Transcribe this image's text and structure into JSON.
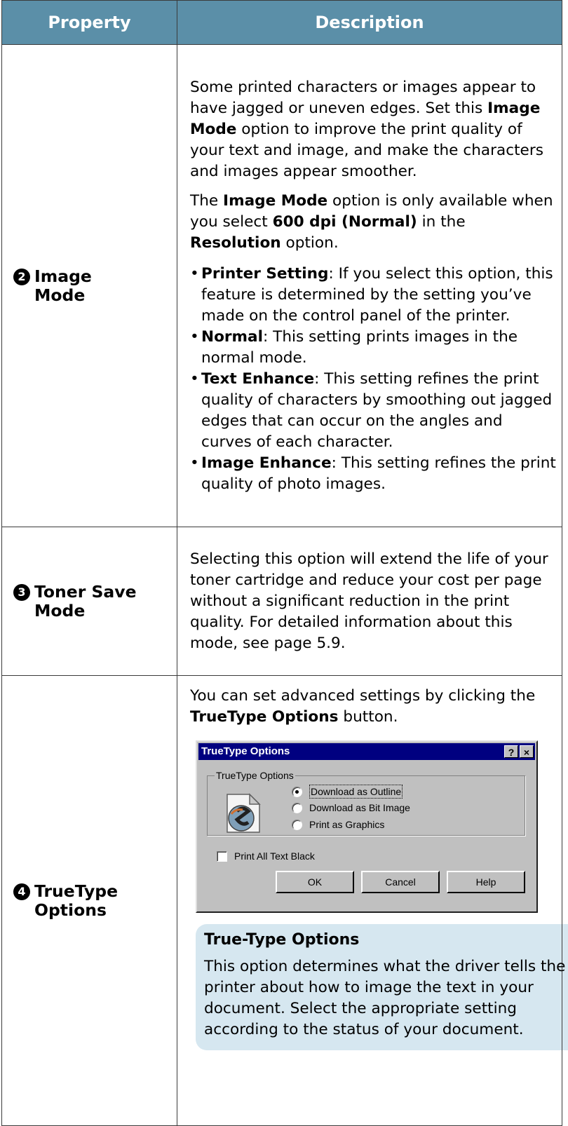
{
  "table": {
    "headers": {
      "property": "Property",
      "description": "Description"
    }
  },
  "rows": {
    "image_mode": {
      "number": "2",
      "name": "Image\nMode",
      "para1": {
        "pre": "Some printed characters or images appear to have jagged or uneven edges. Set this ",
        "bold": "Image Mode",
        "post": " option to improve the print quality of your text and image, and make the characters and images appear smoother."
      },
      "para2": {
        "t1": "The ",
        "b1": "Image Mode",
        "t2": " option is only available when you select ",
        "b2": "600 dpi (Normal)",
        "t3": " in the ",
        "b3": "Resolution",
        "t4": " option."
      },
      "options": [
        {
          "bold": "Printer Setting",
          "text": ": If you select this option, this feature is determined by the setting you’ve made on the control panel of the printer."
        },
        {
          "bold": "Normal",
          "text": ": This setting prints images in the normal mode."
        },
        {
          "bold": "Text Enhance",
          "text": ": This setting refines the print quality of characters by smoothing out jagged edges that can occur on the angles and curves of each character."
        },
        {
          "bold": "Image Enhance",
          "text": ": This setting refines the print quality of photo images."
        }
      ]
    },
    "toner_save": {
      "number": "3",
      "name": "Toner Save\nMode",
      "text": "Selecting this option will extend the life of your toner cartridge and reduce your cost per page without a significant reduction in the print quality. For detailed information about this mode, see page 5.9."
    },
    "truetype": {
      "number": "4",
      "name": "TrueType\nOptions",
      "intro": {
        "pre": "You can set advanced settings by clicking the ",
        "bold": "TrueType Options",
        "post": " button."
      },
      "dialog": {
        "title": "TrueType Options",
        "help_btn": "?",
        "close_btn": "×",
        "group_label": "TrueType Options",
        "radio1": "Download as Outline",
        "radio2": "Download as Bit Image",
        "radio3": "Print as Graphics",
        "selected": "Download as Outline",
        "checkbox": "Print All Text Black",
        "checkbox_checked": false,
        "ok": "OK",
        "cancel": "Cancel",
        "help": "Help"
      },
      "note": {
        "title": "True-Type Options",
        "body": "This option determines what the driver tells the printer about how to image the text in your document. Select the appropriate setting according to the status of your document."
      }
    }
  }
}
